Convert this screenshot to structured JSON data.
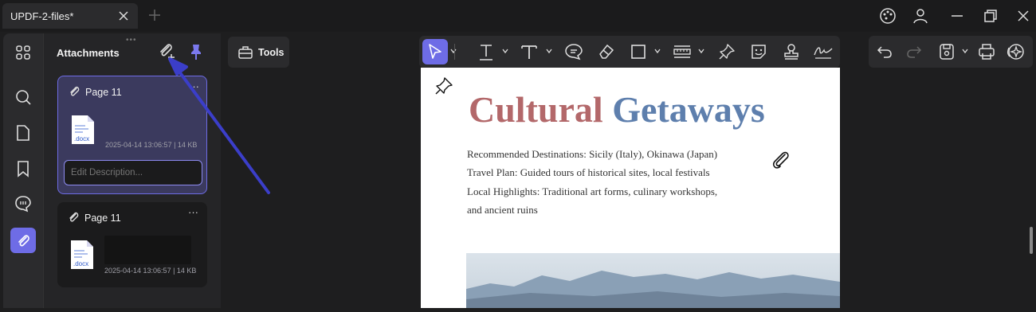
{
  "tab": {
    "title": "UPDF-2-files*"
  },
  "panel": {
    "title": "Attachments"
  },
  "attachments": [
    {
      "page": "Page 11",
      "file_type": ".docx",
      "meta": "2025-04-14 13:06:57 | 14 KB",
      "more": "···"
    },
    {
      "page": "Page 11",
      "file_type": ".docx",
      "meta": "2025-04-14 13:06:57 | 14 KB",
      "more": "···"
    }
  ],
  "description": {
    "placeholder": "Edit Description..."
  },
  "tools": {
    "label": "Tools"
  },
  "document": {
    "heading_part1": "Cultural",
    "heading_part2": "Getaways",
    "lines": [
      "Recommended Destinations: Sicily (Italy), Okinawa (Japan)",
      "Travel Plan: Guided tours of historical sites, local festivals",
      "Local Highlights: Traditional art forms, culinary workshops,",
      "and ancient ruins"
    ]
  },
  "colors": {
    "accent": "#6e6ce6",
    "heading_red": "#b3686a",
    "heading_blue": "#5e7fad",
    "arrow": "#3b3ec9"
  }
}
